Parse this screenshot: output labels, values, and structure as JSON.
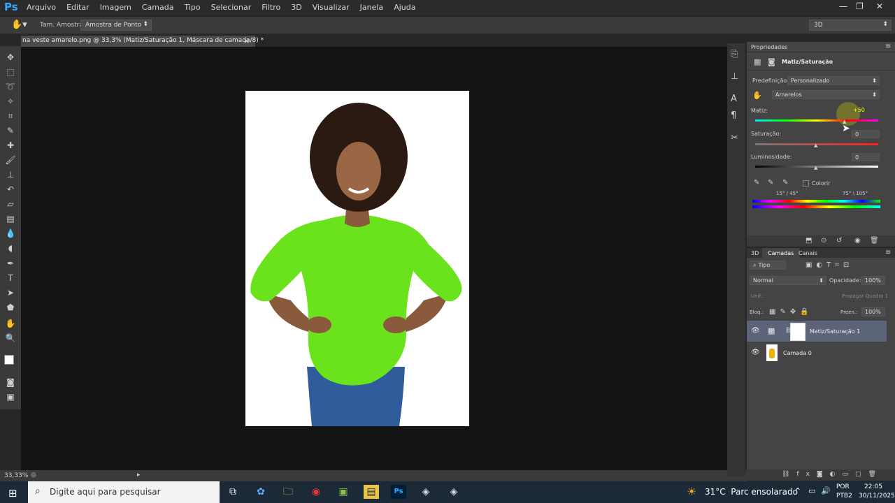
{
  "app": {
    "logo": "Ps"
  },
  "menu": [
    "Arquivo",
    "Editar",
    "Imagem",
    "Camada",
    "Tipo",
    "Selecionar",
    "Filtro",
    "3D",
    "Visualizar",
    "Janela",
    "Ajuda"
  ],
  "options_bar": {
    "sample_size_label": "Tam. Amostra:",
    "sample_size_value": "Amostra de Ponto",
    "workspace": "3D"
  },
  "document": {
    "tab_title": "na veste amarelo.png @ 33,3% (Matiz/Saturação 1, Máscara de camada/8) *",
    "close": "×"
  },
  "status": {
    "zoom": "33,33%"
  },
  "properties": {
    "panel_title": "Propriedades",
    "adjustment_name": "Matiz/Saturação",
    "preset_label": "Predefinição:",
    "preset_value": "Personalizado",
    "range_value": "Amarelos",
    "hue_label": "Matiz:",
    "hue_value": "+50",
    "saturation_label": "Saturação:",
    "saturation_value": "0",
    "lightness_label": "Luminosidade:",
    "lightness_value": "0",
    "colorize_label": "Colorir",
    "range_left": "15° / 45°",
    "range_right": "75° \\ 105°"
  },
  "layers_panel": {
    "tabs": [
      "3D",
      "Camadas",
      "Canais"
    ],
    "filter_kind": "Tipo",
    "blend_mode": "Normal",
    "opacity_label": "Opacidade:",
    "opacity_value": "100%",
    "unify_label": "Unif.:",
    "propagate_label": "Propagar Quadro 1",
    "lock_label": "Bloq.:",
    "fill_label": "Preen.:",
    "fill_value": "100%",
    "layers": [
      {
        "name": "Matiz/Saturação 1",
        "selected": true
      },
      {
        "name": "Camada 0",
        "selected": false
      }
    ]
  },
  "taskbar": {
    "search_placeholder": "Digite aqui para pesquisar",
    "weather": "31°C  Parc ensolarado",
    "lang_top": "POR",
    "lang_bottom": "PTB2",
    "time": "22:05",
    "date": "30/11/2025"
  }
}
